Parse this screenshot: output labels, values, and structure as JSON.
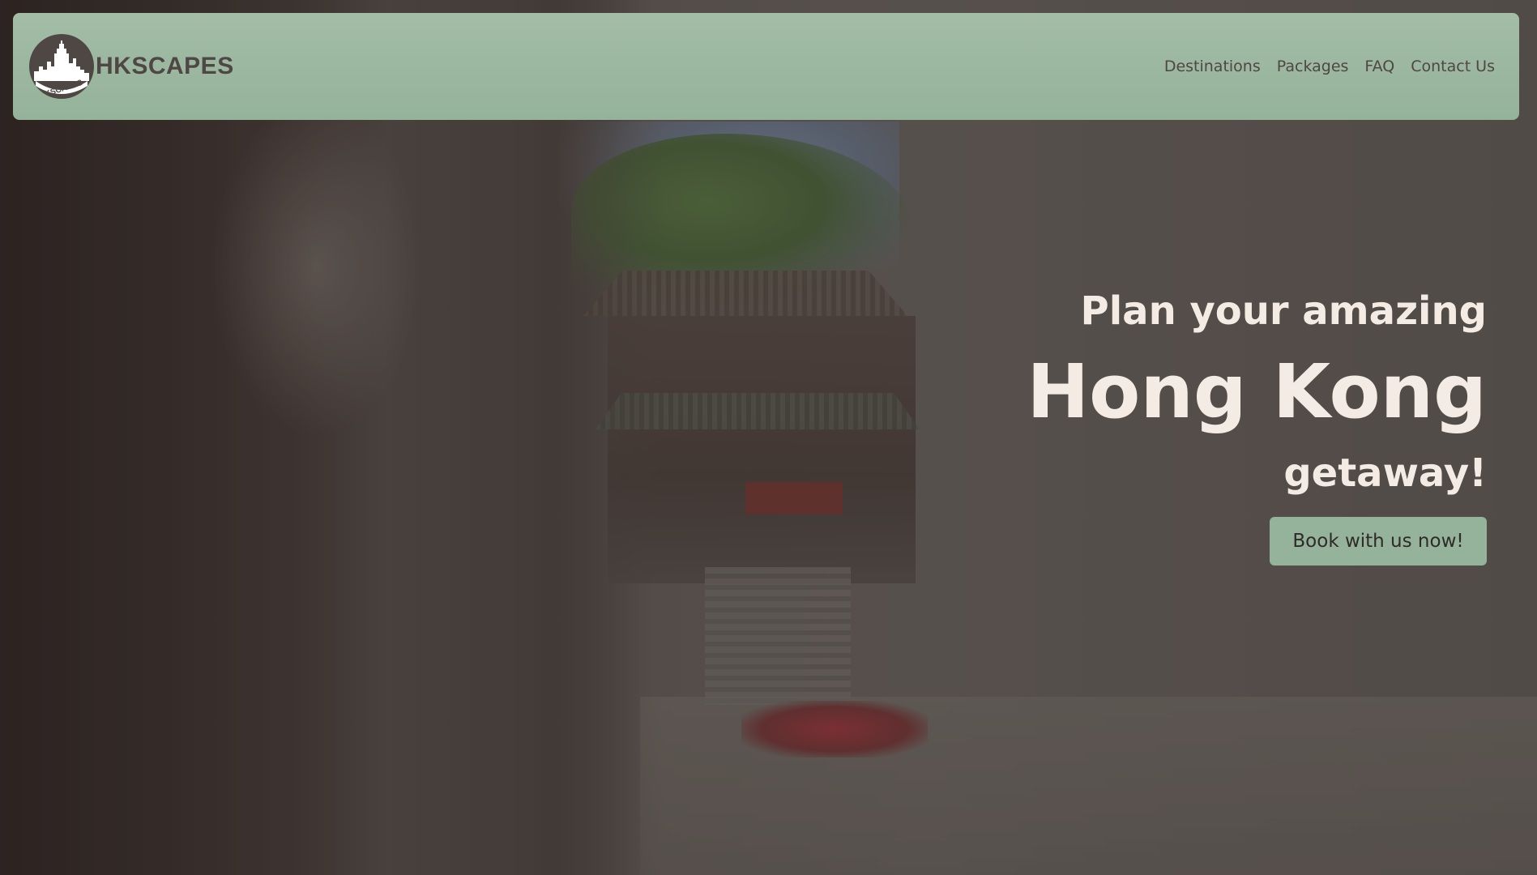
{
  "brand": {
    "name": "HKSCAPES",
    "logo_text": "HKSCAPES"
  },
  "nav": {
    "items": [
      {
        "label": "Destinations"
      },
      {
        "label": "Packages"
      },
      {
        "label": "FAQ"
      },
      {
        "label": "Contact Us"
      }
    ]
  },
  "hero": {
    "line1": "Plan your amazing",
    "line2": "Hong Kong",
    "line3": "getaway!",
    "cta_label": "Book with us now!"
  },
  "colors": {
    "navbar": "#9db8a1",
    "brand_text": "#4e4744",
    "hero_text": "#f4ece4",
    "cta_bg": "#95b29a"
  },
  "icons": {
    "logo": "hong-kong-skyline-logo-icon"
  }
}
